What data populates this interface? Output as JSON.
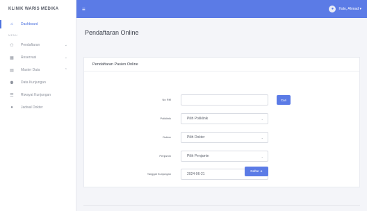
{
  "brand": {
    "name": "KLINIK WARIS MEDIKA"
  },
  "sidebar": {
    "dashboard": {
      "label": "Dashboard",
      "icon": "home-icon"
    },
    "section_label": "MENU",
    "items": [
      {
        "label": "Pendaftaran",
        "icon": "user-add-icon",
        "chevron": "⌄"
      },
      {
        "label": "Reservasi",
        "icon": "calendar-icon",
        "chevron": "⌄"
      },
      {
        "label": "Master Data",
        "icon": "database-icon",
        "chevron": "⌃"
      },
      {
        "label": "Data Kunjungan",
        "icon": "users-icon",
        "chevron": ""
      },
      {
        "label": "Riwayat Kunjungan",
        "icon": "history-icon",
        "chevron": ""
      },
      {
        "label": "Jadwal Dokter",
        "icon": "clock-icon",
        "chevron": ""
      }
    ]
  },
  "topbar": {
    "menu_icon": "≡",
    "user_label": "Halo, Ahmad ▾"
  },
  "page": {
    "title": "Pendaftaran Online"
  },
  "card": {
    "header": "Pendaftaran Pasien Online"
  },
  "form": {
    "no_rm_label": "No RM",
    "no_rm_value": "",
    "cari_label": "Cari",
    "poliklinik_label": "Poliklinik",
    "poliklinik_value": "Pilih Poliklinik",
    "dokter_label": "Dokter",
    "dokter_value": "Pilih Dokter",
    "penjamin_label": "Penjamin",
    "penjamin_value": "Pilih Penjamin",
    "tanggal_label": "Tanggal Kunjungan",
    "tanggal_value": "2024-06-21",
    "submit_label": "Daftar ➔"
  },
  "colors": {
    "accent": "#5b7be6",
    "sidebar_bg": "#ffffff",
    "page_bg": "#f4f5f9"
  }
}
